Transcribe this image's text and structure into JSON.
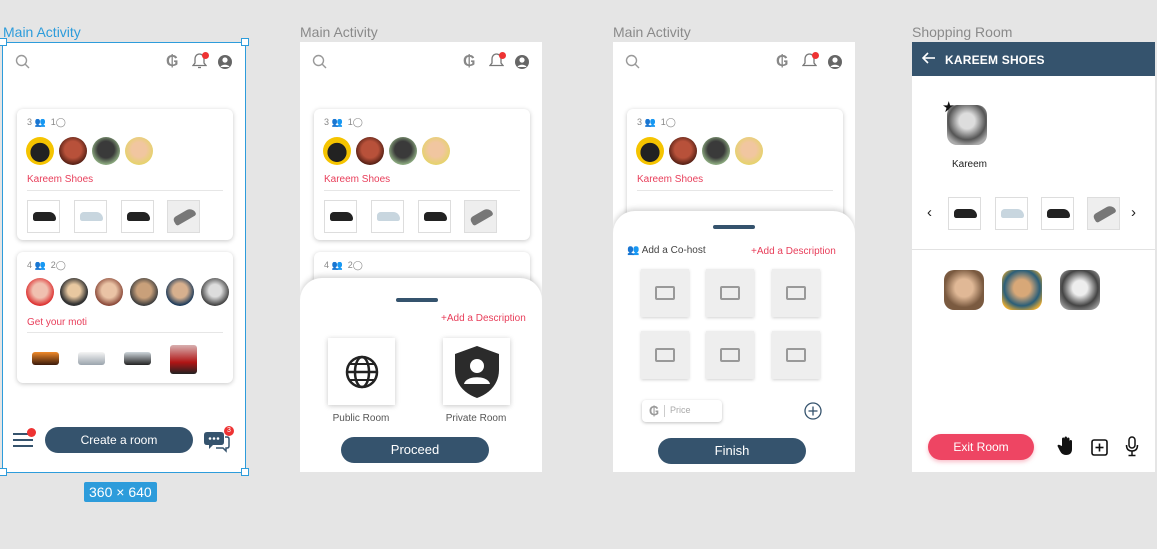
{
  "frames": [
    {
      "label": "Main Activity"
    },
    {
      "label": "Main Activity"
    },
    {
      "label": "Main Activity"
    },
    {
      "label": "Shopping Room"
    }
  ],
  "selection": {
    "dimensions": "360 × 640"
  },
  "cards": {
    "card1": {
      "participants": "3",
      "comments": "1",
      "title": "Kareem Shoes"
    },
    "card2": {
      "participants": "4",
      "comments": "2",
      "title": "Get your moti"
    }
  },
  "main": {
    "create_room": "Create a room",
    "chat_badge": "3"
  },
  "proceed_sheet": {
    "add_description": "+Add a Description",
    "public_room": "Public Room",
    "private_room": "Private Room",
    "proceed": "Proceed"
  },
  "finish_sheet": {
    "add_cohost": "Add a Co-host",
    "add_description": "+Add a Description",
    "price_placeholder": "Price",
    "finish": "Finish"
  },
  "shopping_room": {
    "title": "KAREEM SHOES",
    "host_name": "Kareem",
    "exit_room": "Exit Room"
  },
  "colors": {
    "accent": "#35536d",
    "danger": "#ee4563",
    "selection": "#2d9cdb",
    "link": "#e83e5a"
  },
  "icons": [
    "search-icon",
    "currency-icon",
    "bell-icon",
    "profile-icon",
    "menu-icon",
    "chat-icon",
    "globe-icon",
    "shield-user-icon",
    "image-placeholder-icon",
    "add-circle-icon",
    "back-arrow-icon",
    "star-icon",
    "chevron-left-icon",
    "chevron-right-icon",
    "raise-hand-icon",
    "add-box-icon",
    "microphone-icon"
  ]
}
